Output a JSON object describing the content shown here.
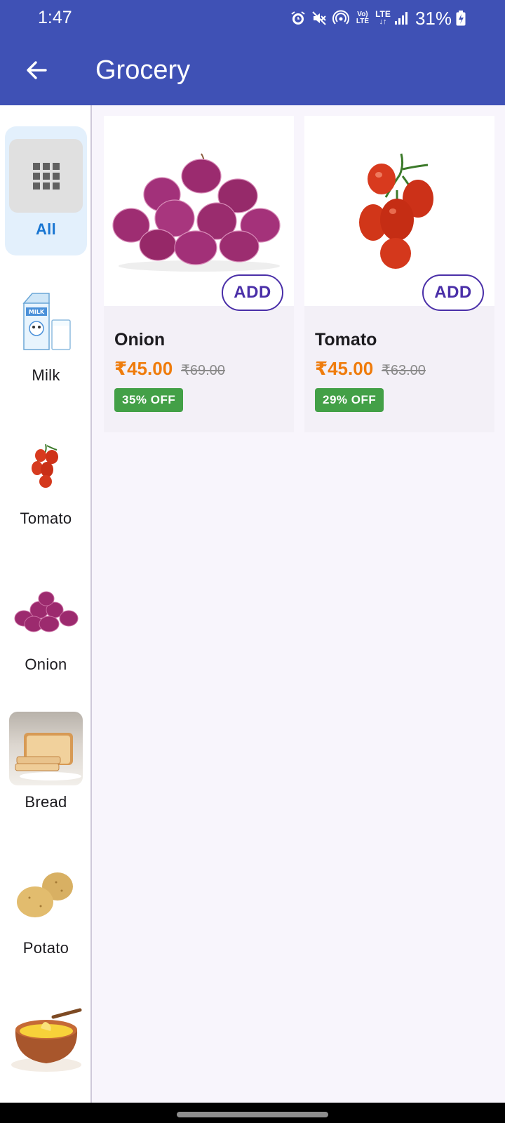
{
  "status_bar": {
    "time": "1:47",
    "battery": "31%",
    "icons": [
      "alarm-icon",
      "mute-icon",
      "hotspot-icon",
      "volte-icon",
      "lte-icon",
      "signal-icon",
      "battery-charging-icon"
    ],
    "volte_top": "Vo)",
    "volte_bottom": "LTE",
    "lte": "LTE"
  },
  "app_bar": {
    "title": "Grocery",
    "back_icon": "arrow-left-icon"
  },
  "sidebar": {
    "items": [
      {
        "label": "All",
        "active": true,
        "icon": "grid-icon"
      },
      {
        "label": "Milk"
      },
      {
        "label": "Tomato"
      },
      {
        "label": "Onion"
      },
      {
        "label": "Bread"
      },
      {
        "label": "Potato"
      },
      {
        "label": ""
      }
    ]
  },
  "products": [
    {
      "name": "Onion",
      "price": "₹45.00",
      "mrp": "₹69.00",
      "discount": "35% OFF",
      "add_label": "ADD"
    },
    {
      "name": "Tomato",
      "price": "₹45.00",
      "mrp": "₹63.00",
      "discount": "29% OFF",
      "add_label": "ADD"
    }
  ],
  "colors": {
    "primary": "#3f51b5",
    "price": "#ef7c0c",
    "discount": "#43a047",
    "add_button": "#4a2fa8",
    "active_category": "#1976d2"
  }
}
